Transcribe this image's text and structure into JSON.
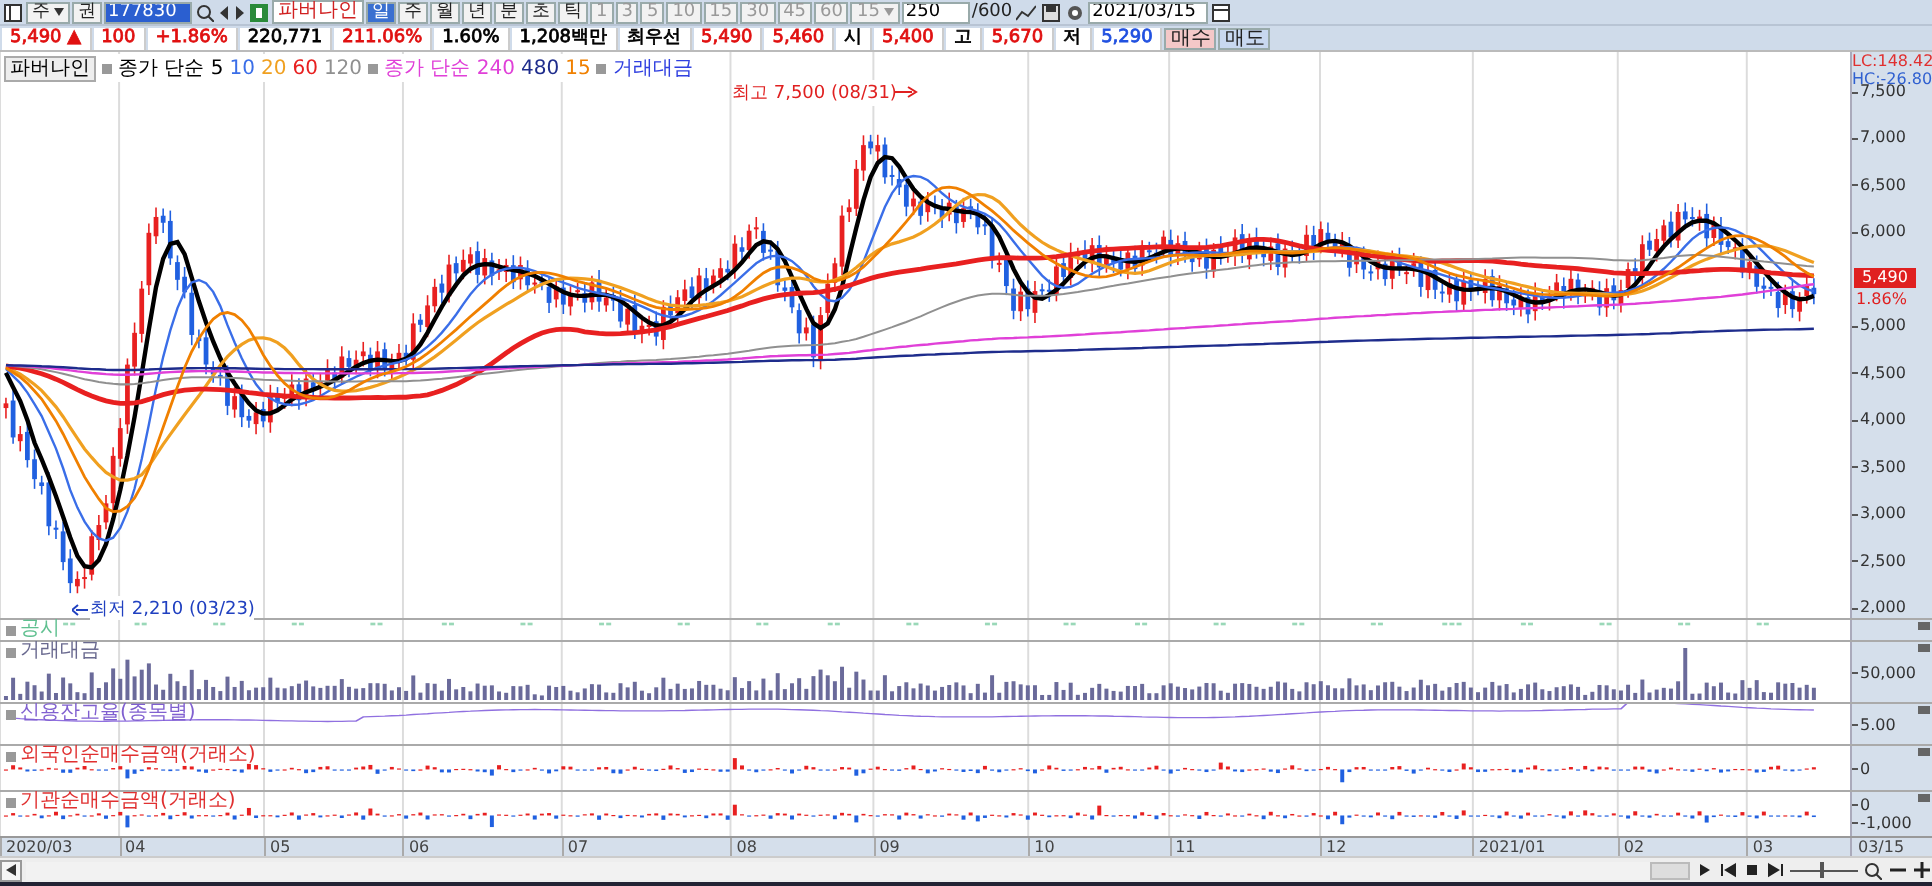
{
  "toolbar": {
    "market": "주",
    "type": "권",
    "code": "177830",
    "name": "파버나인",
    "periods": [
      {
        "label": "일",
        "selected": true
      },
      {
        "label": "주",
        "selected": false
      },
      {
        "label": "월",
        "selected": false
      },
      {
        "label": "년",
        "selected": false
      },
      {
        "label": "분",
        "selected": false
      },
      {
        "label": "초",
        "selected": false
      },
      {
        "label": "틱",
        "selected": false
      }
    ],
    "units": [
      "1",
      "3",
      "5",
      "10",
      "15",
      "30",
      "45",
      "60"
    ],
    "unit_value": "15",
    "count": "250",
    "count_max": "/600",
    "date": "2021/03/15"
  },
  "quote": {
    "cells": [
      {
        "text": "5,490 ▲",
        "color": "#e01010"
      },
      {
        "text": "100",
        "color": "#e01010"
      },
      {
        "text": "+1.86%",
        "color": "#e01010"
      },
      {
        "text": "220,771",
        "color": "#000000"
      },
      {
        "text": "211.06%",
        "color": "#e01010"
      },
      {
        "text": "1.60%",
        "color": "#000000"
      },
      {
        "text": "1,208백만",
        "color": "#000000"
      },
      {
        "text": "최우선",
        "color": "#000000"
      },
      {
        "text": "5,490",
        "color": "#e01010"
      },
      {
        "text": "5,460",
        "color": "#e01010"
      },
      {
        "text": "시",
        "color": "#000000"
      },
      {
        "text": "5,400",
        "color": "#e01010"
      },
      {
        "text": "고",
        "color": "#000000"
      },
      {
        "text": "5,670",
        "color": "#e01010"
      },
      {
        "text": "저",
        "color": "#000000"
      },
      {
        "text": "5,290",
        "color": "#2050e0"
      }
    ],
    "buttons": [
      {
        "label": "매수",
        "color": "#f4c8c8"
      },
      {
        "label": "매도",
        "color": "#c8d8f0"
      }
    ]
  },
  "legend": {
    "stock": "파버나인",
    "items": [
      {
        "label": "종가 단순 5",
        "color": "#000000",
        "marker": true
      },
      {
        "label": "10",
        "color": "#3a6ee8",
        "marker": false
      },
      {
        "label": "20",
        "color": "#f0a020",
        "marker": false
      },
      {
        "label": "60",
        "color": "#e82020",
        "marker": false
      },
      {
        "label": "120",
        "color": "#909090",
        "marker": false
      },
      {
        "label": "종가 단순 240",
        "color": "#e040d8",
        "marker": true
      },
      {
        "label": "480",
        "color": "#1e2c8c",
        "marker": false
      },
      {
        "label": "15",
        "color": "#f08000",
        "marker": false
      },
      {
        "label": "거래대금",
        "color": "#3040e0",
        "marker": true
      }
    ]
  },
  "price_axis": {
    "lc": "LC:148.42",
    "hc": "HC:-26.80",
    "ticks": [
      "7,500",
      "7,000",
      "6,500",
      "6,000",
      "5,000",
      "4,500",
      "4,000",
      "3,500",
      "3,000",
      "2,500",
      "2,000"
    ],
    "current_price": "5,490",
    "current_rate": "1.86%"
  },
  "annotations": {
    "high": "최고 7,500 (08/31)",
    "low": "최저 2,210 (03/23)"
  },
  "panels": [
    {
      "title": "공시",
      "kind": "events",
      "color": "#60c090"
    },
    {
      "title": "거래대금",
      "kind": "bars",
      "color": "#6a6a90",
      "ticks": [
        "50,000"
      ]
    },
    {
      "title": "신용잔고율(종목별)",
      "kind": "line",
      "color": "#8060d0",
      "ticks": [
        "5.00"
      ]
    },
    {
      "title": "외국인순매수금액(거래소)",
      "kind": "netbars",
      "color": "#e03030",
      "ticks": [
        "0"
      ]
    },
    {
      "title": "기관순매수금액(거래소)",
      "kind": "netbars",
      "color": "#e03030",
      "ticks": [
        "0",
        "-1,000"
      ]
    }
  ],
  "x_axis": {
    "labels": [
      "2020/03",
      "04",
      "05",
      "06",
      "07",
      "08",
      "09",
      "10",
      "11",
      "12",
      "2021/01",
      "02",
      "03"
    ],
    "end_label": "03/15"
  },
  "zoom": {
    "level": 0.45
  }
}
